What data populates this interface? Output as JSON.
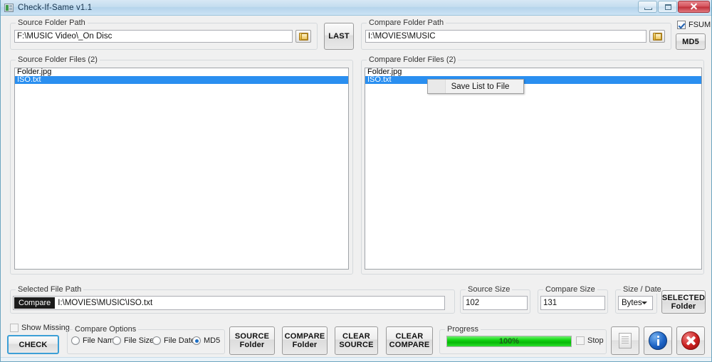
{
  "window": {
    "title": "Check-If-Same v1.1",
    "icon": "app-icon",
    "controls": {
      "minimize": "minimize",
      "maximize": "maximize",
      "close": "close"
    }
  },
  "source_path_group": {
    "label": "Source Folder Path",
    "value": "F:\\MUSIC Video\\_On Disc",
    "browse_icon": "folder-icon"
  },
  "compare_path_group": {
    "label": "Compare Folder Path",
    "value": "I:\\MOVIES\\MUSIC",
    "browse_icon": "folder-icon"
  },
  "last_button": {
    "label": "LAST"
  },
  "fsum": {
    "label": "FSUM",
    "checked": true
  },
  "md5_button": {
    "label": "MD5"
  },
  "source_files_group": {
    "label": "Source Folder Files  (2)",
    "items": [
      {
        "name": "Folder.jpg",
        "selected": false
      },
      {
        "name": "ISO.txt",
        "selected": true
      }
    ]
  },
  "compare_files_group": {
    "label": "Compare Folder Files  (2)",
    "items": [
      {
        "name": "Folder.jpg",
        "selected": false
      },
      {
        "name": "ISO.txt",
        "selected": true
      }
    ]
  },
  "context_menu": {
    "items": [
      {
        "label": "Save List to File"
      }
    ]
  },
  "selected_file_group": {
    "label": "Selected File Path",
    "badge": "Compare",
    "value": "I:\\MOVIES\\MUSIC\\ISO.txt"
  },
  "source_size_group": {
    "label": "Source Size",
    "value": "102"
  },
  "compare_size_group": {
    "label": "Compare Size",
    "value": "131"
  },
  "size_date_group": {
    "label": "Size / Date",
    "selected": "Bytes"
  },
  "selected_folder_button": {
    "line1": "SELECTED",
    "line2": "Folder"
  },
  "show_missing": {
    "label": "Show Missing",
    "checked": false
  },
  "check_button": {
    "label": "CHECK"
  },
  "compare_options": {
    "label": "Compare Options",
    "options": [
      {
        "label": "File Name",
        "selected": false
      },
      {
        "label": "File Size",
        "selected": false
      },
      {
        "label": "File Date",
        "selected": false
      },
      {
        "label": "MD5",
        "selected": true
      }
    ]
  },
  "action_buttons": [
    {
      "line1": "SOURCE",
      "line2": "Folder"
    },
    {
      "line1": "COMPARE",
      "line2": "Folder"
    },
    {
      "line1": "CLEAR",
      "line2": "SOURCE"
    },
    {
      "line1": "CLEAR",
      "line2": "COMPARE"
    }
  ],
  "progress_group": {
    "label": "Progress",
    "percent_text": "100%",
    "percent_value": 100,
    "stop": {
      "label": "Stop",
      "checked": false
    }
  },
  "icon_buttons": [
    {
      "icon": "document-icon"
    },
    {
      "icon": "info-icon"
    },
    {
      "icon": "cancel-icon"
    }
  ],
  "colors": {
    "selection": "#2a8ff0",
    "progress": "#14d814",
    "titlebar": "#c4ddef",
    "close_button": "#bf2e38"
  }
}
